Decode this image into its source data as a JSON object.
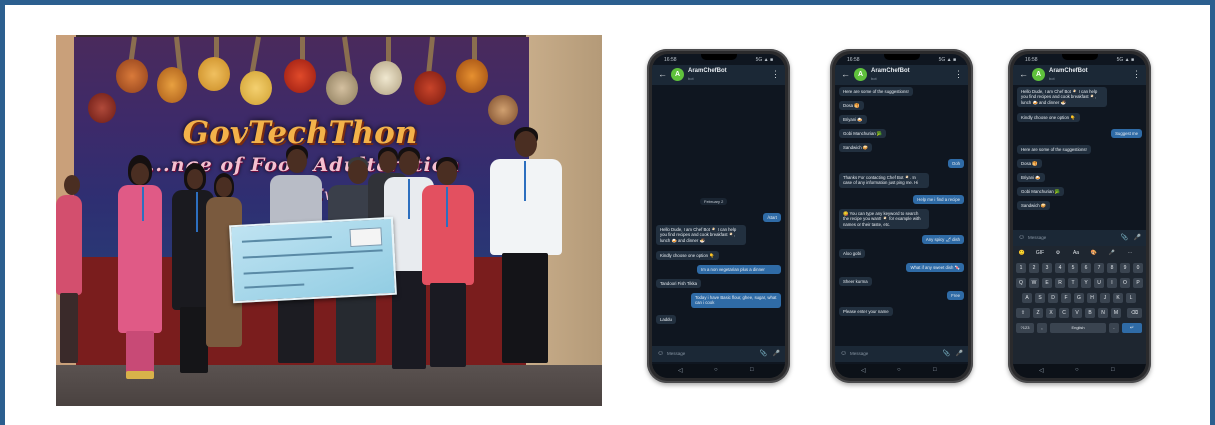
{
  "photo": {
    "banner_title": "GovTechThon",
    "banner_subtitle": "...nge of Food Adulteration",
    "banner_line3": "...n Ev...",
    "logo_left": "",
    "logo_right": ""
  },
  "phones": [
    {
      "status_time": "16:58",
      "status_right": "5G ▲ ■",
      "bot_name": "AramChefBot",
      "bot_status": "bot",
      "date_chip": "February 2",
      "messages": [
        {
          "dir": "out",
          "text": "/start"
        },
        {
          "dir": "in",
          "text": "Hello Dude, I am Chef Bot 🍳 I can help"
        },
        {
          "dir": "in",
          "text": "you find recipes and cook breakfast 🍳,"
        },
        {
          "dir": "in",
          "text": "lunch 🍛 and dinner 🍜"
        },
        {
          "dir": "in",
          "text": "Kindly choose one option 👇"
        },
        {
          "dir": "out",
          "text": "Im a non vegetarian plus a dinner"
        },
        {
          "dir": "in",
          "text": "Tandoori Fish Tikka"
        },
        {
          "dir": "out",
          "text": "Today i have Basic flour, ghee, sugar, what"
        },
        {
          "dir": "out",
          "text": "can i cook"
        },
        {
          "dir": "in",
          "text": "Laddu"
        }
      ],
      "input_placeholder": "Message"
    },
    {
      "status_time": "16:58",
      "status_right": "5G ▲ ■",
      "bot_name": "AramChefBot",
      "bot_status": "bot",
      "messages": [
        {
          "dir": "in",
          "text": "Here are some of the suggestions!"
        },
        {
          "dir": "in",
          "text": "Dosa 🥞"
        },
        {
          "dir": "in",
          "text": "Briyani 🍛"
        },
        {
          "dir": "in",
          "text": "Gobi Manchurian 🥦"
        },
        {
          "dir": "in",
          "text": "Sandwich 🥪"
        },
        {
          "dir": "out",
          "text": "Ooh"
        },
        {
          "dir": "in",
          "text": "Thanks For contacting Chef Bot 🍳. In"
        },
        {
          "dir": "in",
          "text": "case of any information just ping me. Hi"
        },
        {
          "dir": "out",
          "text": "Help me i find a recipe"
        },
        {
          "dir": "in",
          "text": "😋 You can type any keyword to search"
        },
        {
          "dir": "in",
          "text": "the recipe you want! 🍳 for example with"
        },
        {
          "dir": "in",
          "text": "names or their taste, etc."
        },
        {
          "dir": "out",
          "text": "Any spicy 🌶 dish"
        },
        {
          "dir": "in",
          "text": "Aloo gobi"
        },
        {
          "dir": "out",
          "text": "What if any sweet dish 🍬"
        },
        {
          "dir": "in",
          "text": "Sheer kurma"
        },
        {
          "dir": "out",
          "text": "Free"
        },
        {
          "dir": "in",
          "text": "Please enter your name"
        }
      ],
      "input_placeholder": "Message"
    },
    {
      "status_time": "16:58",
      "status_right": "5G ▲ ■",
      "bot_name": "AramChefBot",
      "bot_status": "bot",
      "messages": [
        {
          "dir": "in",
          "text": "Hello Dude, I am Chef Bot 🍳 I can help"
        },
        {
          "dir": "in",
          "text": "you find recipes and cook breakfast 🍳,"
        },
        {
          "dir": "in",
          "text": "lunch 🍛 and dinner 🍜"
        },
        {
          "dir": "in",
          "text": "Kindly choose one option 👇"
        },
        {
          "dir": "out",
          "text": "Suggest me"
        },
        {
          "dir": "in",
          "text": "Here are some of the suggestions!"
        },
        {
          "dir": "in",
          "text": "Dosa 🥞"
        },
        {
          "dir": "in",
          "text": "Briyani 🍛"
        },
        {
          "dir": "in",
          "text": "Gobi Manchurian 🥦"
        },
        {
          "dir": "in",
          "text": "Sandwich 🥪"
        }
      ],
      "input_placeholder": "Message",
      "keyboard": {
        "suggest": [
          "🙂",
          "GIF",
          "⚙",
          "Aa",
          "🎨",
          "🎤",
          "⋯"
        ],
        "row1": [
          "1",
          "2",
          "3",
          "4",
          "5",
          "6",
          "7",
          "8",
          "9",
          "0"
        ],
        "row2": [
          "Q",
          "W",
          "E",
          "R",
          "T",
          "Y",
          "U",
          "I",
          "O",
          "P"
        ],
        "row3": [
          "A",
          "S",
          "D",
          "F",
          "G",
          "H",
          "J",
          "K",
          "L"
        ],
        "row4": [
          "⇧",
          "Z",
          "X",
          "C",
          "V",
          "B",
          "N",
          "M",
          "⌫"
        ],
        "row5": [
          "?123",
          ",",
          "English",
          ".",
          "↵"
        ]
      }
    }
  ],
  "icons": {
    "back": "←",
    "menu": "⋮",
    "emoji": "☺",
    "attach": "📎",
    "mic": "🎤",
    "nav_back": "◁",
    "nav_home": "○",
    "nav_recent": "□"
  }
}
